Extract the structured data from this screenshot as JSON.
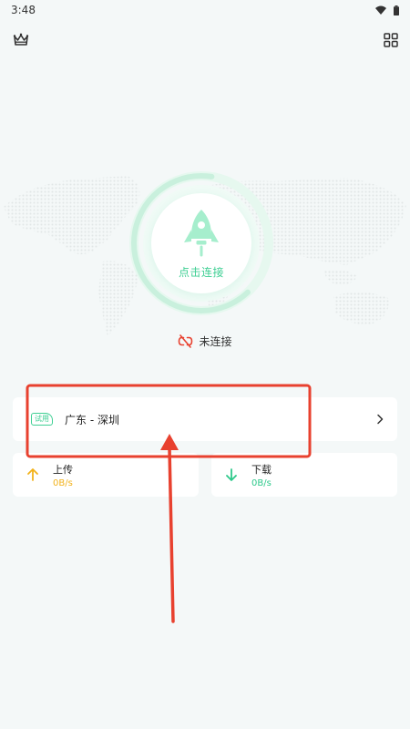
{
  "status_bar": {
    "time": "3:48",
    "wifi_icon": "wifi-icon",
    "battery_icon": "battery-icon"
  },
  "header": {
    "left_icon": "crown-icon",
    "right_icon": "grid-menu-icon"
  },
  "connect_button": {
    "label": "点击连接",
    "icon": "rocket-icon"
  },
  "connection_status": {
    "text": "未连接",
    "icon": "disconnected-link-icon"
  },
  "server": {
    "badge": "试用",
    "name": "广东 - 深圳",
    "icon": "chevron-right-icon"
  },
  "stats": {
    "upload": {
      "label": "上传",
      "value": "0B/s",
      "color": "#f2b21b",
      "icon": "arrow-up-icon"
    },
    "download": {
      "label": "下载",
      "value": "0B/s",
      "color": "#2ec98b",
      "icon": "arrow-down-icon"
    }
  },
  "colors": {
    "accent": "#3ecf93",
    "highlight_red": "#e8412f",
    "background": "#f4f8f8"
  }
}
